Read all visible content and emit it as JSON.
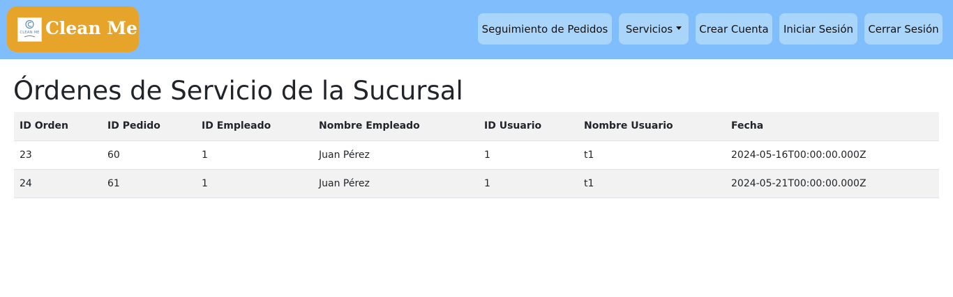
{
  "navbar": {
    "brand": "Clean Me",
    "logo_text": "CLEAN ME",
    "links": {
      "seguimiento": "Seguimiento de Pedidos",
      "servicios": "Servicios",
      "crear_cuenta": "Crear Cuenta",
      "iniciar_sesion": "Iniciar Sesión",
      "cerrar_sesion": "Cerrar Sesión"
    },
    "colors": {
      "bar": "#7fbdfd",
      "brand_bg": "#e7a42b",
      "button_bg": "#a9d5fb"
    }
  },
  "page": {
    "title": "Órdenes de Servicio de la Sucursal"
  },
  "table": {
    "headers": [
      "ID Orden",
      "ID Pedido",
      "ID Empleado",
      "Nombre Empleado",
      "ID Usuario",
      "Nombre Usuario",
      "Fecha"
    ],
    "rows": [
      [
        "23",
        "60",
        "1",
        "Juan Pérez",
        "1",
        "t1",
        "2024-05-16T00:00:00.000Z"
      ],
      [
        "24",
        "61",
        "1",
        "Juan Pérez",
        "1",
        "t1",
        "2024-05-21T00:00:00.000Z"
      ]
    ]
  }
}
